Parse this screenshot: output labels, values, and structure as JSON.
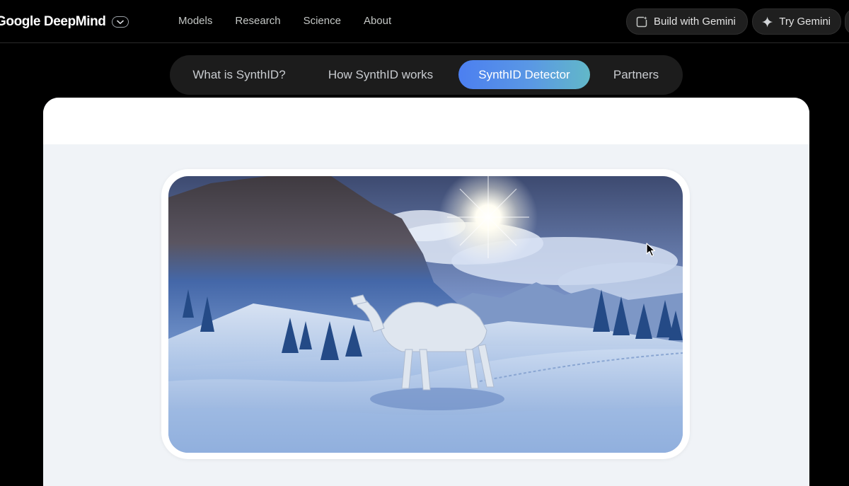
{
  "header": {
    "brand": "Google DeepMind",
    "nav": [
      "Models",
      "Research",
      "Science",
      "About"
    ],
    "build_label": "Build with Gemini",
    "try_label": "Try Gemini"
  },
  "tabs": [
    {
      "label": "What is SynthID?",
      "active": false
    },
    {
      "label": "How SynthID works",
      "active": false
    },
    {
      "label": "SynthID Detector",
      "active": true
    },
    {
      "label": "Partners",
      "active": false
    }
  ],
  "colors": {
    "background": "#000000",
    "active_tab_start": "#4c7ff0",
    "active_tab_end": "#62b8c8",
    "card": "#f0f3f7"
  },
  "icons": {
    "brand_toggle": "chevron-down-icon",
    "build": "build-icon",
    "try": "sparkle-icon"
  }
}
